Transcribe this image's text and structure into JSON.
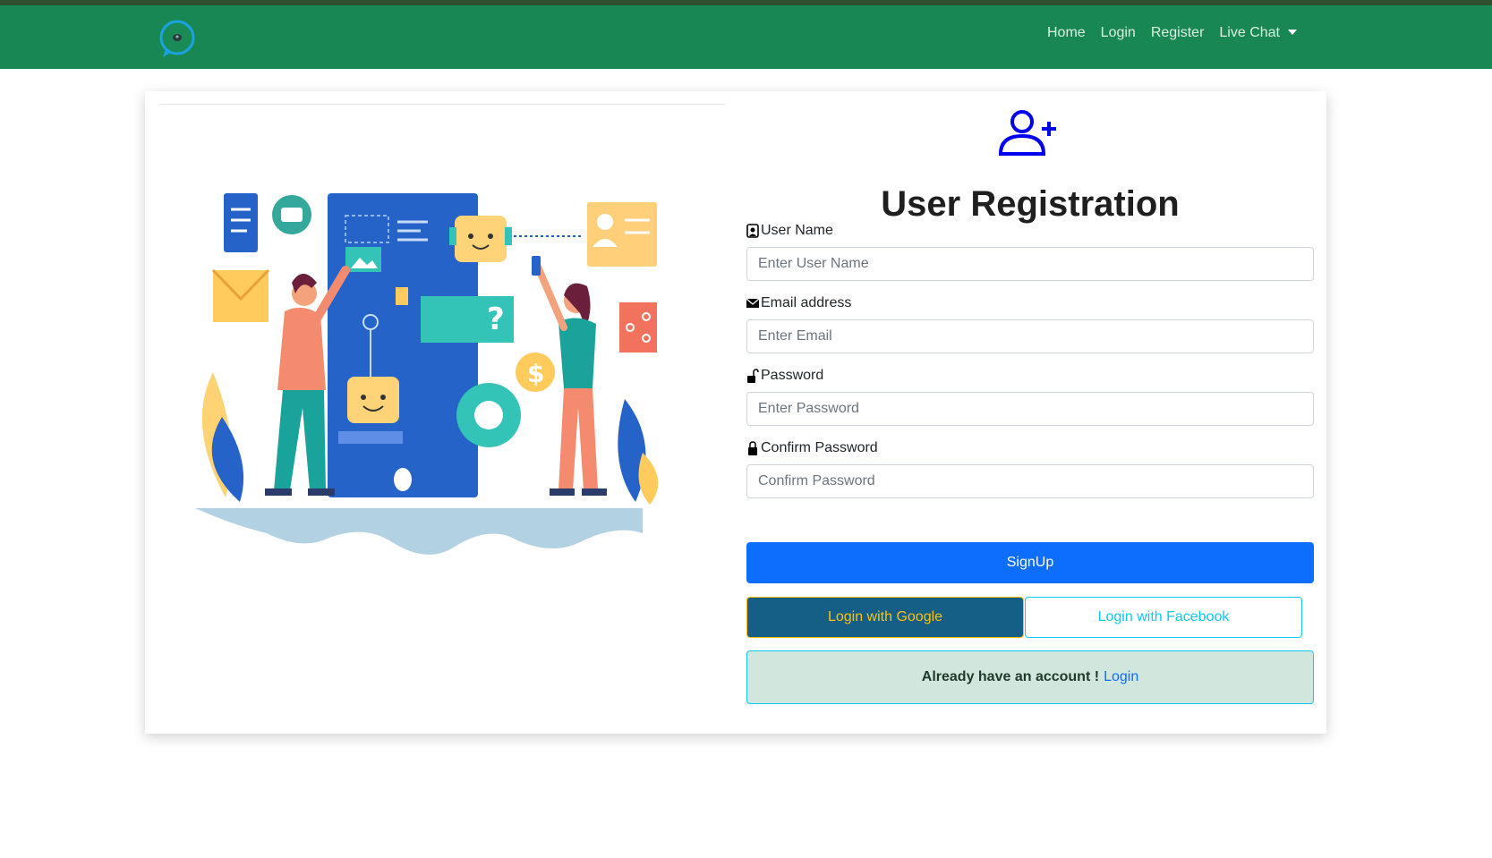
{
  "nav": {
    "logo": "chat-bubble-logo",
    "links": [
      "Home",
      "Login",
      "Register",
      "Live Chat"
    ],
    "dropdown_icon": "caret-down-icon"
  },
  "colors": {
    "navbar": "#198754",
    "primary": "#0d6efd",
    "google_bg": "#155e85",
    "google_text": "#ffc107",
    "facebook": "#0dcaf0",
    "alert_bg": "#d1e7dd"
  },
  "form": {
    "header_icon": "user-plus-icon",
    "title": "User Registration",
    "fields": [
      {
        "label": "User Name",
        "icon": "person-badge-icon",
        "placeholder": "Enter User Name"
      },
      {
        "label": "Email address",
        "icon": "envelope-icon",
        "placeholder": "Enter Email"
      },
      {
        "label": "Password",
        "icon": "unlock-icon",
        "placeholder": "Enter Password"
      },
      {
        "label": "Confirm Password",
        "icon": "lock-icon",
        "placeholder": "Confirm Password"
      }
    ],
    "signup_label": "SignUp",
    "google_label": "Login with Google",
    "facebook_label": "Login with Facebook",
    "account_text": "Already have an account !",
    "login_link": "Login"
  }
}
